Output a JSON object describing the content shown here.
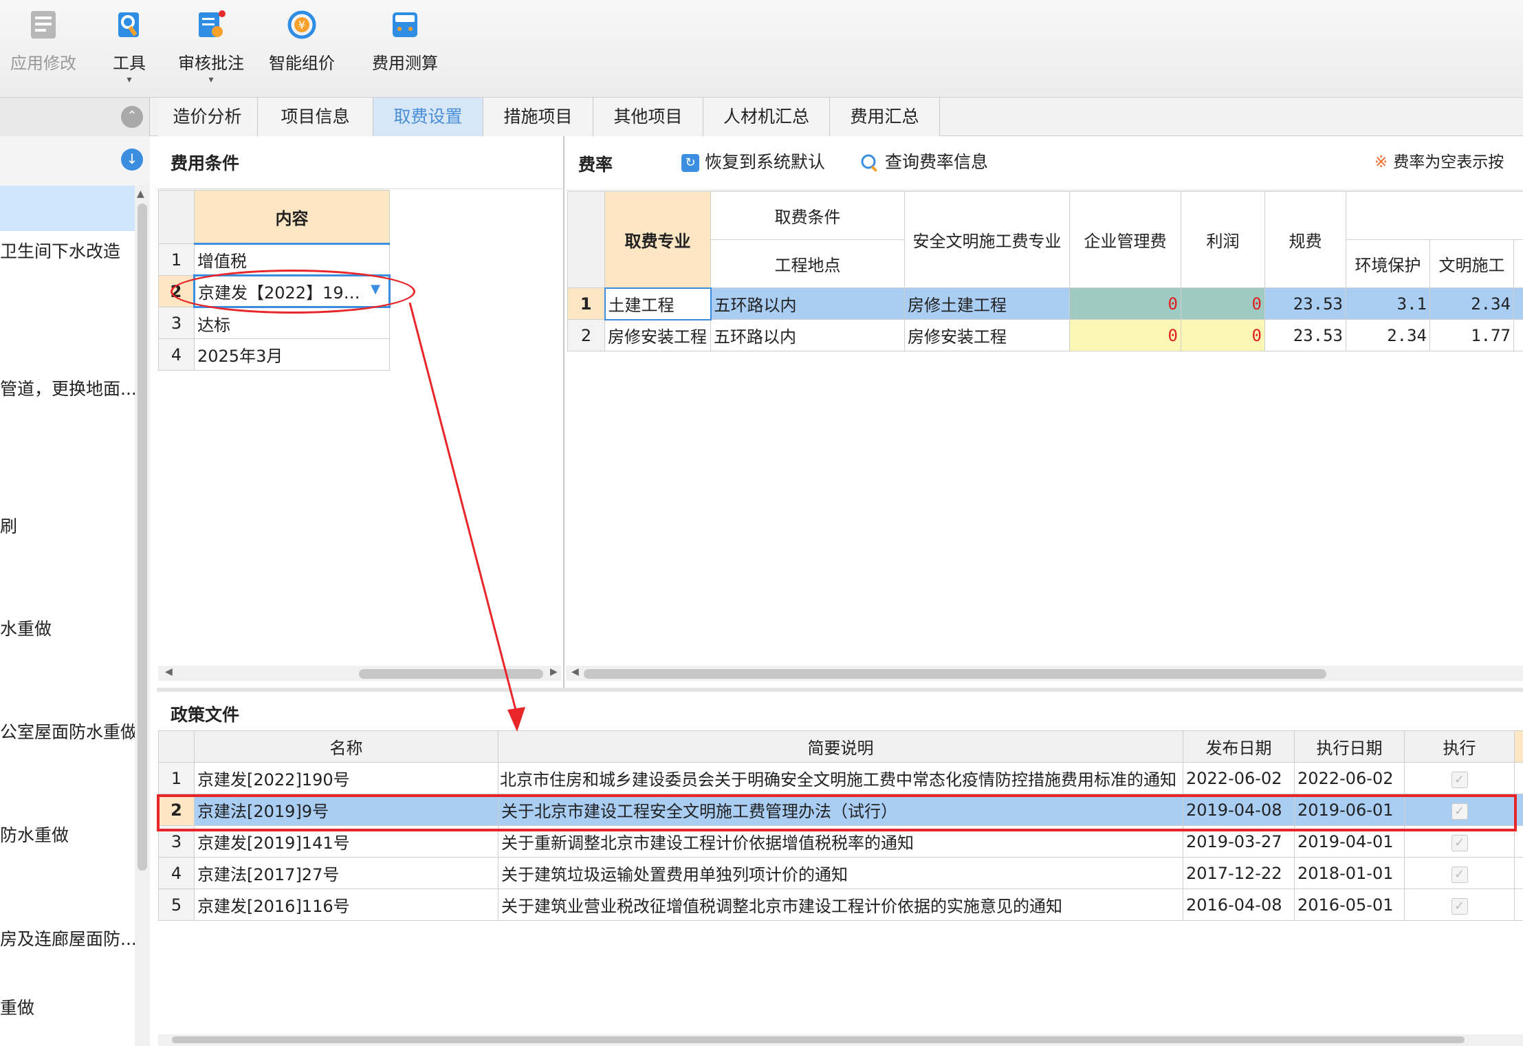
{
  "toolbar": {
    "items": [
      {
        "label": "应用修改",
        "icon": "apply-changes-icon",
        "disabled": true
      },
      {
        "label": "工具",
        "icon": "tools-icon"
      },
      {
        "label": "审核批注",
        "icon": "review-annotate-icon"
      },
      {
        "label": "智能组价",
        "icon": "smart-pricing-icon"
      },
      {
        "label": "费用测算",
        "icon": "cost-calculator-icon"
      }
    ]
  },
  "tabs": [
    {
      "label": "造价分析"
    },
    {
      "label": "项目信息"
    },
    {
      "label": "取费设置",
      "active": true
    },
    {
      "label": "措施项目"
    },
    {
      "label": "其他项目"
    },
    {
      "label": "人材机汇总"
    },
    {
      "label": "费用汇总"
    }
  ],
  "left_panel": {
    "items": [
      "卫生间下水改造",
      "管道，更换地面...",
      "刷",
      "水重做",
      "公室屋面防水重做",
      "防水重做",
      "房及连廊屋面防...",
      "重做"
    ]
  },
  "fee_conditions": {
    "title": "费用条件",
    "header": "内容",
    "rows": [
      {
        "num": "1",
        "content": "增值税"
      },
      {
        "num": "2",
        "content": "京建发【2022】19…"
      },
      {
        "num": "3",
        "content": "达标"
      },
      {
        "num": "4",
        "content": "2025年3月"
      }
    ]
  },
  "fee_rates": {
    "title": "费率",
    "restore_label": "恢复到系统默认",
    "query_label": "查询费率信息",
    "note": "费率为空表示按",
    "headers": {
      "specialty": "取费专业",
      "condition": "取费条件",
      "location": "工程地点",
      "safety": "安全文明施工费专业",
      "mgmt": "企业管理费",
      "profit": "利润",
      "fees": "规费",
      "env": "环境保护",
      "civil": "文明施工"
    },
    "rows": [
      {
        "num": "1",
        "specialty": "土建工程",
        "location": "五环路以内",
        "safety": "房修土建工程",
        "mgmt": "0",
        "profit": "0",
        "fees": "23.53",
        "env": "3.1",
        "civil": "2.34"
      },
      {
        "num": "2",
        "specialty": "房修安装工程",
        "location": "五环路以内",
        "safety": "房修安装工程",
        "mgmt": "0",
        "profit": "0",
        "fees": "23.53",
        "env": "2.34",
        "civil": "1.77"
      }
    ]
  },
  "policy": {
    "title": "政策文件",
    "headers": {
      "name": "名称",
      "desc": "简要说明",
      "publish": "发布日期",
      "effective": "执行日期",
      "execute": "执行"
    },
    "rows": [
      {
        "num": "1",
        "name": "京建发[2022]190号",
        "desc": "北京市住房和城乡建设委员会关于明确安全文明施工费中常态化疫情防控措施费用标准的通知",
        "publish": "2022-06-02",
        "effective": "2022-06-02",
        "checked": true
      },
      {
        "num": "2",
        "name": "京建法[2019]9号",
        "desc": "关于北京市建设工程安全文明施工费管理办法（试行）",
        "publish": "2019-04-08",
        "effective": "2019-06-01",
        "checked": true
      },
      {
        "num": "3",
        "name": "京建发[2019]141号",
        "desc": "关于重新调整北京市建设工程计价依据增值税税率的通知",
        "publish": "2019-03-27",
        "effective": "2019-04-01",
        "checked": true
      },
      {
        "num": "4",
        "name": "京建法[2017]27号",
        "desc": "关于建筑垃圾运输处置费用单独列项计价的通知",
        "publish": "2017-12-22",
        "effective": "2018-01-01",
        "checked": true
      },
      {
        "num": "5",
        "name": "京建发[2016]116号",
        "desc": "关于建筑业营业税改征增值税调整北京市建设工程计价依据的实施意见的通知",
        "publish": "2016-04-08",
        "effective": "2016-05-01",
        "checked": true
      }
    ]
  },
  "colors": {
    "accent": "#3b8de0",
    "selection": "#a9cdf3",
    "annotation": "#e8262a",
    "header_peach": "#fde6c3"
  }
}
